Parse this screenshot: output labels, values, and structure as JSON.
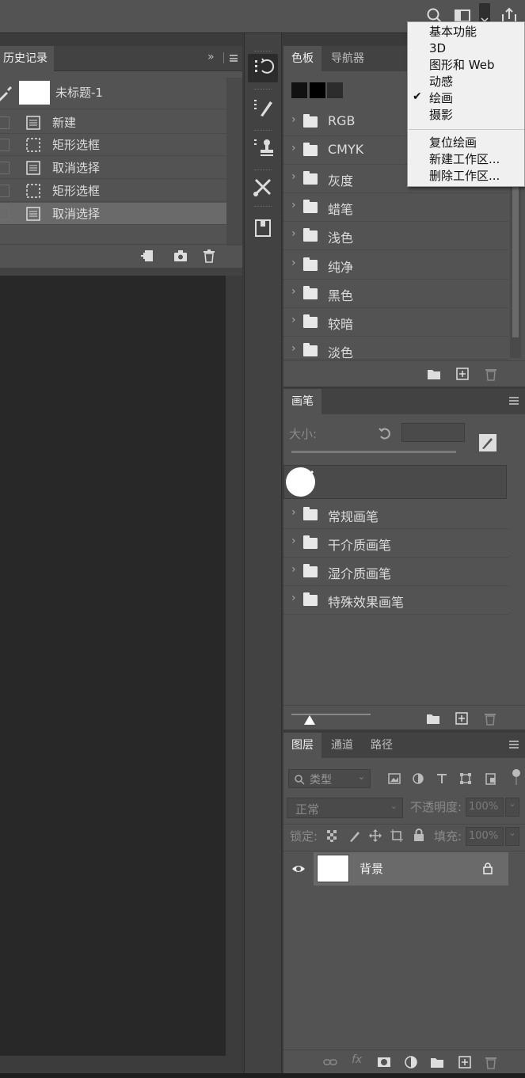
{
  "history": {
    "tab": "历史记录",
    "snapshot": "未标题-1",
    "steps": [
      {
        "label": "新建",
        "icon": "document-icon"
      },
      {
        "label": "矩形选框",
        "icon": "marquee-icon"
      },
      {
        "label": "取消选择",
        "icon": "document-icon"
      },
      {
        "label": "矩形选框",
        "icon": "marquee-icon"
      },
      {
        "label": "取消选择",
        "icon": "document-icon",
        "selected": true
      }
    ]
  },
  "swatches": {
    "tabs": [
      "色板",
      "导航器"
    ],
    "folders": [
      "RGB",
      "CMYK",
      "灰度",
      "蜡笔",
      "浅色",
      "纯净",
      "黑色",
      "较暗",
      "淡色"
    ]
  },
  "brushes": {
    "tab": "画笔",
    "size_label": "大小:",
    "folders": [
      "常规画笔",
      "干介质画笔",
      "湿介质画笔",
      "特殊效果画笔"
    ]
  },
  "layers": {
    "tabs": [
      "图层",
      "通道",
      "路径"
    ],
    "filter_kind": "类型",
    "blend_mode": "正常",
    "opacity_label": "不透明度:",
    "opacity_value": "100%",
    "lock_label": "锁定:",
    "fill_label": "填充:",
    "fill_value": "100%",
    "layer_name": "背景"
  },
  "workspace_menu": {
    "items": [
      "基本功能",
      "3D",
      "图形和 Web",
      "动感",
      "绘画",
      "摄影"
    ],
    "checked": "绘画",
    "actions": [
      "复位绘画",
      "新建工作区...",
      "删除工作区..."
    ]
  },
  "colors": {
    "accent": "#535353",
    "selected_row": "#6a6a6a"
  }
}
